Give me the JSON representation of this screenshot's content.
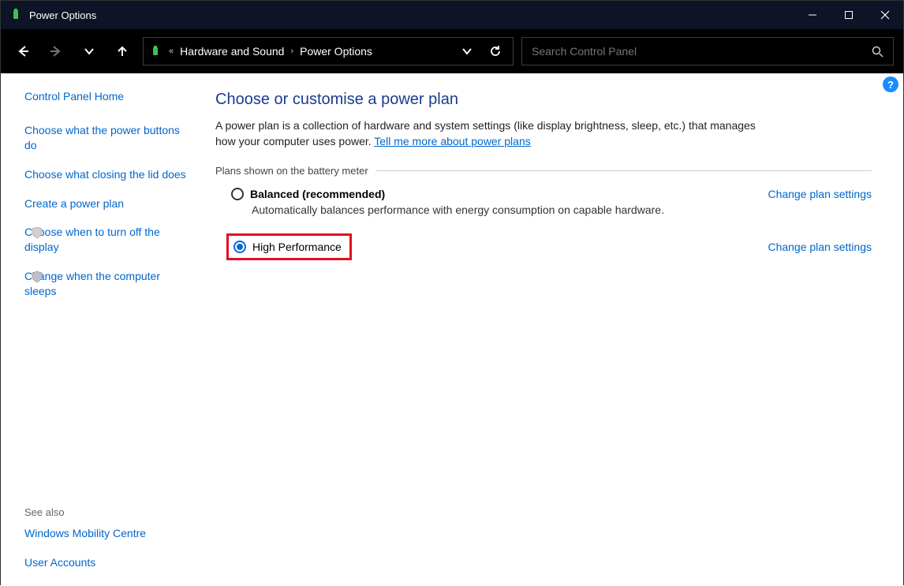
{
  "window": {
    "title": "Power Options"
  },
  "breadcrumb": {
    "parent": "Hardware and Sound",
    "current": "Power Options"
  },
  "search": {
    "placeholder": "Search Control Panel"
  },
  "sidebar": {
    "home": "Control Panel Home",
    "links": [
      "Choose what the power buttons do",
      "Choose what closing the lid does",
      "Create a power plan",
      "Choose when to turn off the display",
      "Change when the computer sleeps"
    ],
    "see_also_hdr": "See also",
    "see_also": [
      "Windows Mobility Centre",
      "User Accounts"
    ]
  },
  "main": {
    "heading": "Choose or customise a power plan",
    "desc_pre": "A power plan is a collection of hardware and system settings (like display brightness, sleep, etc.) that manages how your computer uses power. ",
    "desc_link": "Tell me more about power plans",
    "group_label": "Plans shown on the battery meter",
    "plans": [
      {
        "name": "Balanced (recommended)",
        "sub": "Automatically balances performance with energy consumption on capable hardware.",
        "selected": false,
        "change": "Change plan settings"
      },
      {
        "name": "High Performance",
        "sub": "",
        "selected": true,
        "change": "Change plan settings"
      }
    ]
  }
}
